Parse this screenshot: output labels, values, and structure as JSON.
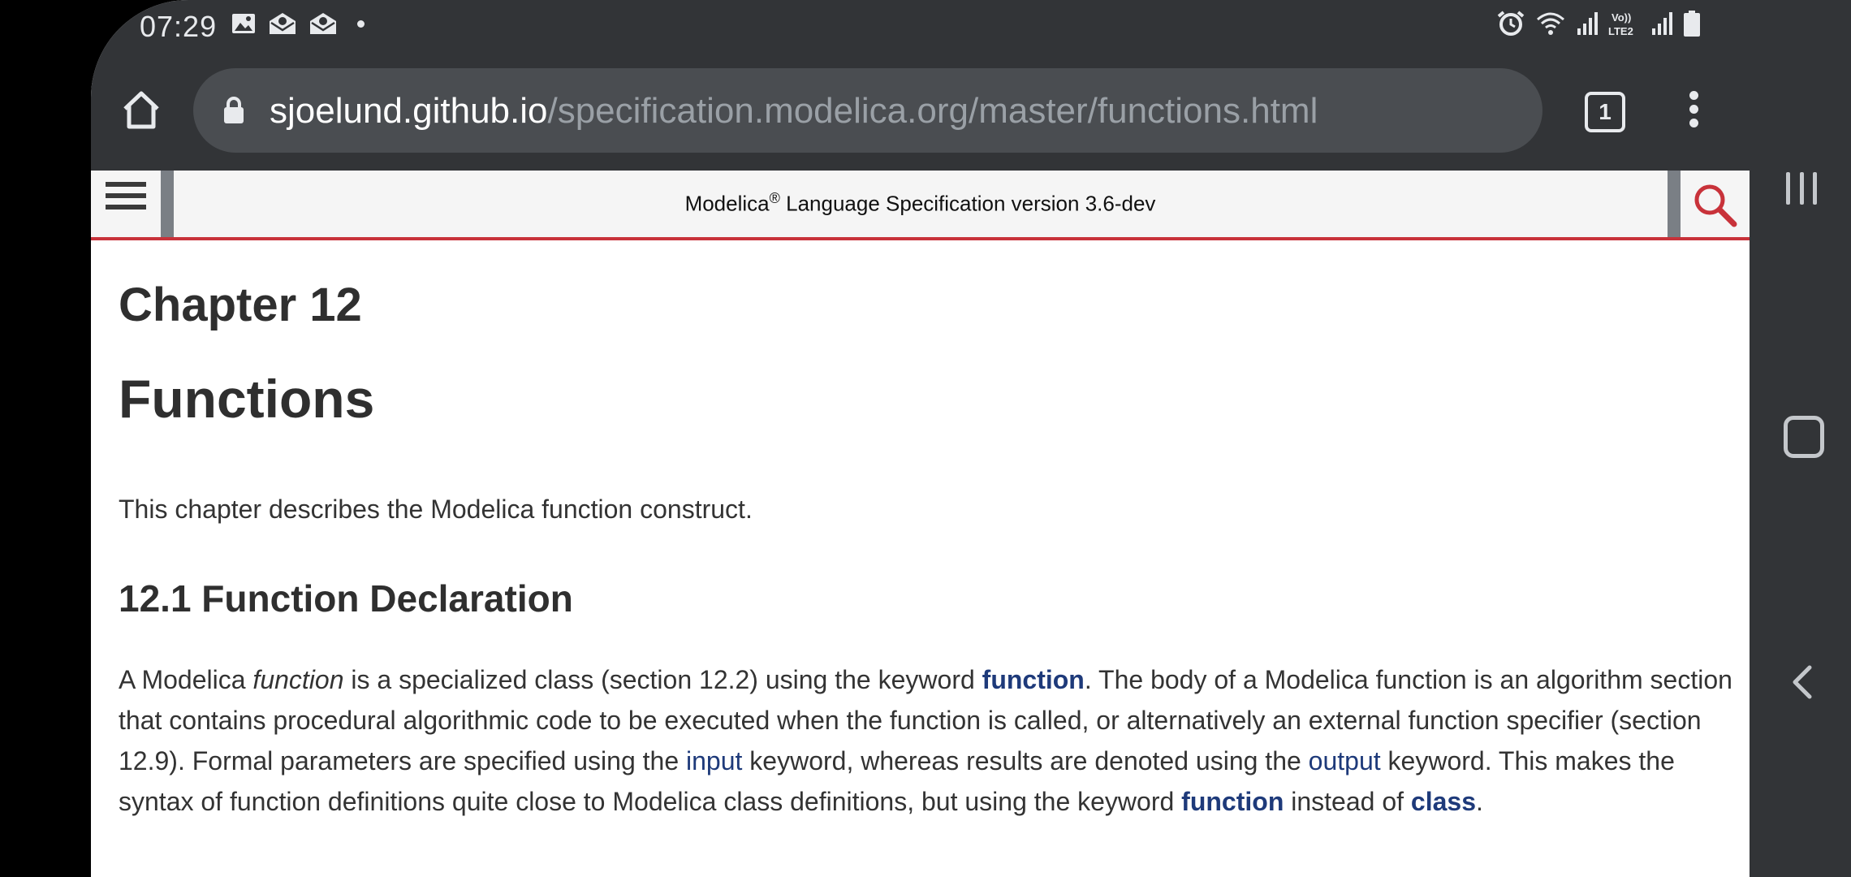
{
  "status_bar": {
    "time": "07:29"
  },
  "browser": {
    "url_host": "sjoelund.github.io",
    "url_path": "/specification.modelica.org/master/functions.html",
    "tab_count": "1"
  },
  "site_header": {
    "title_pre": "Modelica",
    "title_sup": "®",
    "title_post": " Language Specification version 3.6-dev"
  },
  "content": {
    "chapter": "Chapter 12",
    "title": "Functions",
    "intro": "This chapter describes the Modelica function construct.",
    "section_heading": "12.1 Function Declaration",
    "para": {
      "t1": "A Modelica ",
      "em1": "function",
      "t2": " is a specialized class (section 12.2) using the keyword ",
      "kw1": "function",
      "t3": ". The body of a Modelica function is an algorithm section that contains procedural algorithmic code to be executed when the function is called, or alternatively an external function specifier (section 12.9). Formal parameters are specified using the ",
      "ref1": "input",
      "t4": " keyword, whereas results are denoted using the ",
      "ref2": "output",
      "t5": " keyword. This makes the syntax of function definitions quite close to Modelica class definitions, but using the keyword ",
      "kw2": "function",
      "t6": " instead of ",
      "kw3": "class",
      "t7": "."
    }
  },
  "colors": {
    "accent": "#c8323a",
    "link": "#1e3a7a",
    "chrome": "#323437"
  }
}
